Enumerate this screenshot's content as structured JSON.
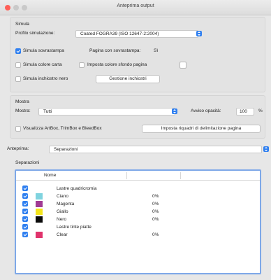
{
  "window": {
    "title": "Anteprima output"
  },
  "simula": {
    "section_label": "Simula",
    "profile_label": "Profilo simulazione:",
    "profile_value": "Coated FOGRA39 (ISO 12647-2:2004)",
    "simulate_overprint": "Simula sovrastampa",
    "simulate_overprint_checked": true,
    "overprint_page_label": "Pagina con sovrastampa:",
    "overprint_page_value": "Sì",
    "simulate_paper": "Simula colore carta",
    "simulate_paper_checked": false,
    "set_page_bg": "Imposta colore sfondo pagina",
    "set_page_bg_checked": false,
    "simulate_black_ink": "Simula inchiostro nero",
    "simulate_black_ink_checked": false,
    "ink_manager_button": "Gestione inchiostri"
  },
  "mostra": {
    "section_label": "Mostra",
    "show_label": "Mostra:",
    "show_value": "Tutti",
    "opacity_label": "Avviso opacità:",
    "opacity_value": "100",
    "opacity_unit": "%",
    "show_boxes": "Visualizza ArtBox, TrimBox e BleedBox",
    "show_boxes_checked": false,
    "set_boxes_button": "Imposta riquadri di delimitazione pagina"
  },
  "anteprima": {
    "label": "Anteprima:",
    "value": "Separazioni"
  },
  "separazioni": {
    "section_label": "Separazioni",
    "column_name": "Nome",
    "rows": [
      {
        "name": "Lastre quadricromia",
        "percent": "",
        "checked": true,
        "swatch": ""
      },
      {
        "name": "Ciano",
        "percent": "0%",
        "checked": true,
        "swatch": "#7fd3df"
      },
      {
        "name": "Magenta",
        "percent": "0%",
        "checked": true,
        "swatch": "#a13a93"
      },
      {
        "name": "Giallo",
        "percent": "0%",
        "checked": true,
        "swatch": "#f4e51c"
      },
      {
        "name": "Nero",
        "percent": "0%",
        "checked": true,
        "swatch": "#0a0a0a"
      },
      {
        "name": "Lastre tinte piatte",
        "percent": "",
        "checked": true,
        "swatch": ""
      },
      {
        "name": "Clear",
        "percent": "0%",
        "checked": true,
        "swatch": "#e0336c"
      }
    ]
  },
  "colors": {
    "accent": "#2f7ff0",
    "focus_ring": "#7ea8e8",
    "window_bg": "#e7e7e7"
  }
}
